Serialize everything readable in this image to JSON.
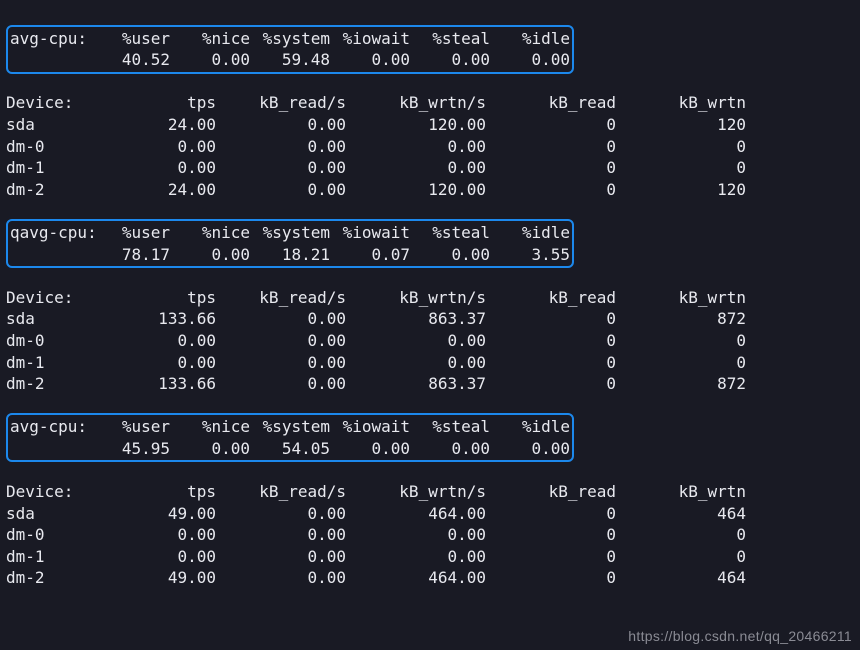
{
  "cpu_header": {
    "label": "avg-cpu:",
    "label_q": "qavg-cpu:",
    "user": "%user",
    "nice": "%nice",
    "system": "%system",
    "iowait": "%iowait",
    "steal": "%steal",
    "idle": "%idle"
  },
  "dev_header": {
    "label": "Device:",
    "tps": "tps",
    "kbrs": "kB_read/s",
    "kbws": "kB_wrtn/s",
    "kbr": "kB_read",
    "kbw": "kB_wrtn"
  },
  "blocks": [
    {
      "cpu": {
        "user": "40.52",
        "nice": "0.00",
        "system": "59.48",
        "iowait": "0.00",
        "steal": "0.00",
        "idle": "0.00"
      },
      "devices": [
        {
          "name": "sda",
          "tps": "24.00",
          "kbrs": "0.00",
          "kbws": "120.00",
          "kbr": "0",
          "kbw": "120"
        },
        {
          "name": "dm-0",
          "tps": "0.00",
          "kbrs": "0.00",
          "kbws": "0.00",
          "kbr": "0",
          "kbw": "0"
        },
        {
          "name": "dm-1",
          "tps": "0.00",
          "kbrs": "0.00",
          "kbws": "0.00",
          "kbr": "0",
          "kbw": "0"
        },
        {
          "name": "dm-2",
          "tps": "24.00",
          "kbrs": "0.00",
          "kbws": "120.00",
          "kbr": "0",
          "kbw": "120"
        }
      ]
    },
    {
      "cpu": {
        "user": "78.17",
        "nice": "0.00",
        "system": "18.21",
        "iowait": "0.07",
        "steal": "0.00",
        "idle": "3.55"
      },
      "devices": [
        {
          "name": "sda",
          "tps": "133.66",
          "kbrs": "0.00",
          "kbws": "863.37",
          "kbr": "0",
          "kbw": "872"
        },
        {
          "name": "dm-0",
          "tps": "0.00",
          "kbrs": "0.00",
          "kbws": "0.00",
          "kbr": "0",
          "kbw": "0"
        },
        {
          "name": "dm-1",
          "tps": "0.00",
          "kbrs": "0.00",
          "kbws": "0.00",
          "kbr": "0",
          "kbw": "0"
        },
        {
          "name": "dm-2",
          "tps": "133.66",
          "kbrs": "0.00",
          "kbws": "863.37",
          "kbr": "0",
          "kbw": "872"
        }
      ]
    },
    {
      "cpu": {
        "user": "45.95",
        "nice": "0.00",
        "system": "54.05",
        "iowait": "0.00",
        "steal": "0.00",
        "idle": "0.00"
      },
      "devices": [
        {
          "name": "sda",
          "tps": "49.00",
          "kbrs": "0.00",
          "kbws": "464.00",
          "kbr": "0",
          "kbw": "464"
        },
        {
          "name": "dm-0",
          "tps": "0.00",
          "kbrs": "0.00",
          "kbws": "0.00",
          "kbr": "0",
          "kbw": "0"
        },
        {
          "name": "dm-1",
          "tps": "0.00",
          "kbrs": "0.00",
          "kbws": "0.00",
          "kbr": "0",
          "kbw": "0"
        },
        {
          "name": "dm-2",
          "tps": "49.00",
          "kbrs": "0.00",
          "kbws": "464.00",
          "kbr": "0",
          "kbw": "464"
        }
      ]
    }
  ],
  "watermark": "https://blog.csdn.net/qq_20466211",
  "chart_data": {
    "type": "table",
    "title": "iostat output samples",
    "samples": [
      {
        "avg_cpu": {
          "%user": 40.52,
          "%nice": 0.0,
          "%system": 59.48,
          "%iowait": 0.0,
          "%steal": 0.0,
          "%idle": 0.0
        },
        "devices": [
          {
            "Device": "sda",
            "tps": 24.0,
            "kB_read/s": 0.0,
            "kB_wrtn/s": 120.0,
            "kB_read": 0,
            "kB_wrtn": 120
          },
          {
            "Device": "dm-0",
            "tps": 0.0,
            "kB_read/s": 0.0,
            "kB_wrtn/s": 0.0,
            "kB_read": 0,
            "kB_wrtn": 0
          },
          {
            "Device": "dm-1",
            "tps": 0.0,
            "kB_read/s": 0.0,
            "kB_wrtn/s": 0.0,
            "kB_read": 0,
            "kB_wrtn": 0
          },
          {
            "Device": "dm-2",
            "tps": 24.0,
            "kB_read/s": 0.0,
            "kB_wrtn/s": 120.0,
            "kB_read": 0,
            "kB_wrtn": 120
          }
        ]
      },
      {
        "avg_cpu": {
          "%user": 78.17,
          "%nice": 0.0,
          "%system": 18.21,
          "%iowait": 0.07,
          "%steal": 0.0,
          "%idle": 3.55
        },
        "devices": [
          {
            "Device": "sda",
            "tps": 133.66,
            "kB_read/s": 0.0,
            "kB_wrtn/s": 863.37,
            "kB_read": 0,
            "kB_wrtn": 872
          },
          {
            "Device": "dm-0",
            "tps": 0.0,
            "kB_read/s": 0.0,
            "kB_wrtn/s": 0.0,
            "kB_read": 0,
            "kB_wrtn": 0
          },
          {
            "Device": "dm-1",
            "tps": 0.0,
            "kB_read/s": 0.0,
            "kB_wrtn/s": 0.0,
            "kB_read": 0,
            "kB_wrtn": 0
          },
          {
            "Device": "dm-2",
            "tps": 133.66,
            "kB_read/s": 0.0,
            "kB_wrtn/s": 863.37,
            "kB_read": 0,
            "kB_wrtn": 872
          }
        ]
      },
      {
        "avg_cpu": {
          "%user": 45.95,
          "%nice": 0.0,
          "%system": 54.05,
          "%iowait": 0.0,
          "%steal": 0.0,
          "%idle": 0.0
        },
        "devices": [
          {
            "Device": "sda",
            "tps": 49.0,
            "kB_read/s": 0.0,
            "kB_wrtn/s": 464.0,
            "kB_read": 0,
            "kB_wrtn": 464
          },
          {
            "Device": "dm-0",
            "tps": 0.0,
            "kB_read/s": 0.0,
            "kB_wrtn/s": 0.0,
            "kB_read": 0,
            "kB_wrtn": 0
          },
          {
            "Device": "dm-1",
            "tps": 0.0,
            "kB_read/s": 0.0,
            "kB_wrtn/s": 0.0,
            "kB_read": 0,
            "kB_wrtn": 0
          },
          {
            "Device": "dm-2",
            "tps": 49.0,
            "kB_read/s": 0.0,
            "kB_wrtn/s": 464.0,
            "kB_read": 0,
            "kB_wrtn": 464
          }
        ]
      }
    ]
  }
}
